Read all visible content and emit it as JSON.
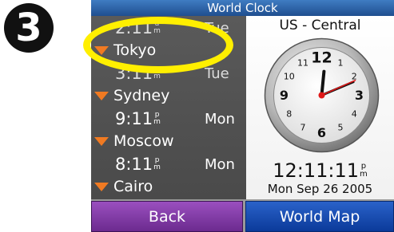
{
  "step": {
    "number": "3"
  },
  "window": {
    "title": "World Clock"
  },
  "clocks": [
    {
      "time": "2:11",
      "ampm": [
        "a",
        "m"
      ],
      "day": "Tue",
      "city": "Tokyo"
    },
    {
      "time": "3:11",
      "ampm": [
        "a",
        "m"
      ],
      "day": "Tue",
      "city": "Sydney"
    },
    {
      "time": "9:11",
      "ampm": [
        "p",
        "m"
      ],
      "day": "Mon",
      "city": "Moscow"
    },
    {
      "time": "8:11",
      "ampm": [
        "p",
        "m"
      ],
      "day": "Mon",
      "city": "Cairo"
    }
  ],
  "detail": {
    "zone": "US - Central",
    "time": "12:11:11",
    "ampm": [
      "p",
      "m"
    ],
    "date": "Mon Sep 26 2005",
    "dial_numbers": [
      "12",
      "1",
      "2",
      "3",
      "4",
      "5",
      "6",
      "7",
      "8",
      "9",
      "10",
      "11"
    ]
  },
  "buttons": {
    "back": "Back",
    "world_map": "World Map"
  },
  "colors": {
    "title_bar": "#2f65ab",
    "back_button": "#7f3aa6",
    "map_button": "#1a4bb3",
    "city_marker": "#f07a22",
    "highlight": "#ffef00",
    "second_hand": "#e01818"
  }
}
